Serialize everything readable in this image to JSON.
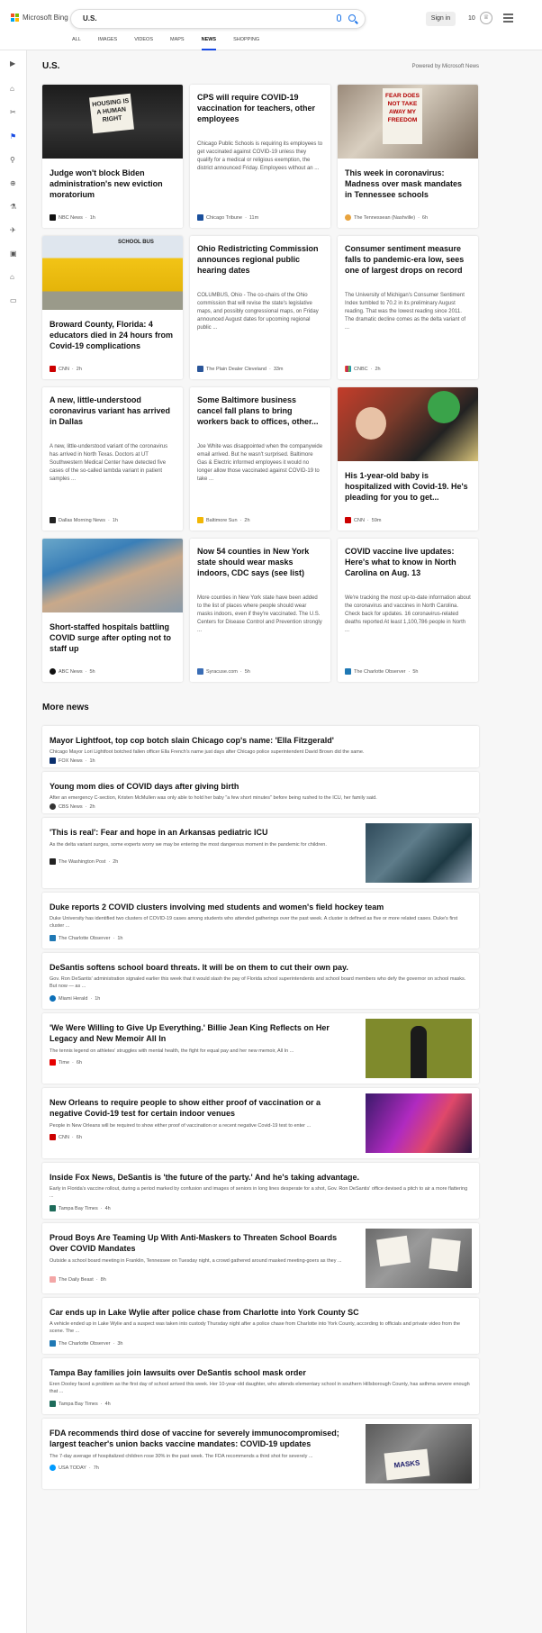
{
  "header": {
    "brand": "Microsoft Bing",
    "query": "U.S.",
    "signin": "Sign in",
    "points": "10",
    "tabs": [
      "ALL",
      "IMAGES",
      "VIDEOS",
      "MAPS",
      "NEWS",
      "SHOPPING"
    ]
  },
  "section": {
    "title": "U.S.",
    "powered": "Powered by Microsoft News",
    "more": "More news"
  },
  "cards": [
    {
      "title": "Judge won't block Biden administration's new eviction moratorium",
      "snippet": "",
      "source": "NBC News",
      "time": "1h",
      "img_sign": "HOUSING IS A HUMAN RIGHT",
      "icon_color": "#111"
    },
    {
      "title": "CPS will require COVID-19 vaccination for teachers, other employees",
      "snippet": "Chicago Public Schools is requiring its employees to get vaccinated against COVID-19 unless they qualify for a medical or religious exemption, the district announced Friday. Employees without an ...",
      "source": "Chicago Tribune",
      "time": "11m",
      "icon_color": "#1a4f9c"
    },
    {
      "title": "This week in coronavirus: Madness over mask mandates in Tennessee schools",
      "snippet": "",
      "source": "The Tennessean (Nashville)",
      "time": "6h",
      "img_sign": "FEAR DOES NOT TAKE AWAY MY FREEDOM",
      "icon_color": "#e8a33d"
    },
    {
      "title": "Broward County, Florida: 4 educators died in 24 hours from Covid-19 complications",
      "snippet": "",
      "source": "CNN",
      "time": "2h",
      "img_sign": "SCHOOL BUS",
      "icon_color": "#cc0000"
    },
    {
      "title": "Ohio Redistricting Commission announces regional public hearing dates",
      "snippet": "COLUMBUS, Ohio - The co-chairs of the Ohio commission that will revise the state's legislative maps, and possibly congressional maps, on Friday announced August dates for upcoming regional public ...",
      "source": "The Plain Dealer Cleveland",
      "time": "33m",
      "icon_color": "#2a5599"
    },
    {
      "title": "Consumer sentiment measure falls to pandemic-era low, sees one of largest drops on record",
      "snippet": "The University of Michigan's Consumer Sentiment Index tumbled to 70.2 in its preliminary August reading. That was the lowest reading since 2011. The dramatic decline comes as the delta variant of ...",
      "source": "CNBC",
      "time": "2h",
      "icon_color": "#f58220"
    },
    {
      "title": "A new, little-understood coronavirus variant has arrived in Dallas",
      "snippet": "A new, little-understood variant of the coronavirus has arrived in North Texas. Doctors at UT Southwestern Medical Center have detected five cases of the so-called lambda variant in patient samples ...",
      "source": "Dallas Morning News",
      "time": "1h",
      "icon_color": "#222"
    },
    {
      "title": "Some Baltimore business cancel fall plans to bring workers back to offices, other...",
      "snippet": "Joe White was disappointed when the companywide email arrived. But he wasn't surprised. Baltimore Gas & Electric informed employees it would no longer allow those vaccinated against COVID-19 to take ...",
      "source": "Baltimore Sun",
      "time": "2h",
      "icon_color": "#f2b705"
    },
    {
      "title": "His 1-year-old baby is hospitalized with Covid-19. He's pleading for you to get...",
      "snippet": "",
      "source": "CNN",
      "time": "59m",
      "icon_color": "#cc0000"
    },
    {
      "title": "Short-staffed hospitals battling COVID surge after opting not to staff up",
      "snippet": "",
      "source": "ABC News",
      "time": "5h",
      "icon_color": "#111"
    },
    {
      "title": "Now 54 counties in New York state should wear masks indoors, CDC says (see list)",
      "snippet": "More counties in New York state have been added to the list of places where people should wear masks indoors, even if they're vaccinated. The U.S. Centers for Disease Control and Prevention strongly ...",
      "source": "Syracuse.com",
      "time": "5h",
      "icon_color": "#3a6db5"
    },
    {
      "title": "COVID vaccine live updates: Here's what to know in North Carolina on Aug. 13",
      "snippet": "We're tracking the most up-to-date information about the coronavirus and vaccines in North Carolina. Check back for updates. 16 coronavirus-related deaths reported At least 1,100,786 people in North ...",
      "source": "The Charlotte Observer",
      "time": "5h",
      "icon_color": "#1f78b4"
    }
  ],
  "more": [
    {
      "title": "Mayor Lightfoot, top cop botch slain Chicago cop's name: 'Ella Fitzgerald'",
      "snippet": "Chicago Mayor Lori Lightfoot botched fallen officer Ella French's name just days after Chicago police superintendent David Brown did the same.",
      "source": "FOX News",
      "time": "1h",
      "icon_color": "#0a2f6e"
    },
    {
      "title": "Young mom dies of COVID days after giving birth",
      "snippet": "After an emergency C-section, Kristen McMullen was only able to hold her baby \"a few short minutes\" before being rushed to the ICU, her family said.",
      "source": "CBS News",
      "time": "2h",
      "icon_color": "#333"
    },
    {
      "title": "'This is real': Fear and hope in an Arkansas pediatric ICU",
      "snippet": "As the delta variant surges, some experts worry we may be entering the most dangerous moment in the pandemic for children.",
      "source": "The Washington Post",
      "time": "2h",
      "icon_color": "#222"
    },
    {
      "title": "Duke reports 2 COVID clusters involving med students and women's field hockey team",
      "snippet": "Duke University has identified two clusters of COVID-19 cases among students who attended gatherings over the past week. A cluster is defined as five or more related cases. Duke's first cluster ...",
      "source": "The Charlotte Observer",
      "time": "1h",
      "icon_color": "#1f78b4"
    },
    {
      "title": "DeSantis softens school board threats. It will be on them to cut their own pay.",
      "snippet": "Gov. Ron DeSantis' administration signaled earlier this week that it would slash the pay of Florida school superintendents and school board members who defy the governor on school masks. But now — as ...",
      "source": "Miami Herald",
      "time": "1h",
      "icon_color": "#0c6fb8"
    },
    {
      "title": "'We Were Willing to Give Up Everything.' Billie Jean King Reflects on Her Legacy and New Memoir All In",
      "snippet": "The tennis legend on athletes' struggles with mental health, the fight for equal pay and her new memoir, All In ...",
      "source": "Time",
      "time": "6h",
      "icon_color": "#e60000"
    },
    {
      "title": "New Orleans to require people to show either proof of vaccination or a negative Covid-19 test for certain indoor venues",
      "snippet": "People in New Orleans will be required to show either proof of vaccination or a recent negative Covid-19 test to enter ...",
      "source": "CNN",
      "time": "6h",
      "icon_color": "#cc0000"
    },
    {
      "title": "Inside Fox News, DeSantis is 'the future of the party.' And he's taking advantage.",
      "snippet": "Early in Florida's vaccine rollout, during a period marked by confusion and images of seniors in long lines desperate for a shot, Gov. Ron DeSantis' office devised a pitch to air a more flattering ...",
      "source": "Tampa Bay Times",
      "time": "4h",
      "icon_color": "#1d6b5a"
    },
    {
      "title": "Proud Boys Are Teaming Up With Anti-Maskers to Threaten School Boards Over COVID Mandates",
      "snippet": "Outside a school board meeting in Franklin, Tennessee on Tuesday night, a crowd gathered around masked meeting-goers as they ...",
      "source": "The Daily Beast",
      "time": "8h",
      "icon_color": "#f3a6a6"
    },
    {
      "title": "Car ends up in Lake Wylie after police chase from Charlotte into York County SC",
      "snippet": "A vehicle ended up in Lake Wylie and a suspect was taken into custody Thursday night after a police chase from Charlotte into York County, according to officials and private video from the scene. The ...",
      "source": "The Charlotte Observer",
      "time": "3h",
      "icon_color": "#1f78b4"
    },
    {
      "title": "Tampa Bay families join lawsuits over DeSantis school mask order",
      "snippet": "Eren Dooley faced a problem as the first day of school arrived this week. Her 10-year-old daughter, who attends elementary school in southern Hillsborough County, has asthma severe enough that ...",
      "source": "Tampa Bay Times",
      "time": "4h",
      "icon_color": "#1d6b5a"
    },
    {
      "title": "FDA recommends third dose of vaccine for severely immunocompromised; largest teacher's union backs vaccine mandates: COVID-19 updates",
      "snippet": "The 7-day average of hospitalized children rose 30% in the past week. The FDA recommends a third shot for severely ...",
      "source": "USA TODAY",
      "time": "7h",
      "icon_color": "#009bff",
      "img_sign": "MASKS"
    }
  ]
}
